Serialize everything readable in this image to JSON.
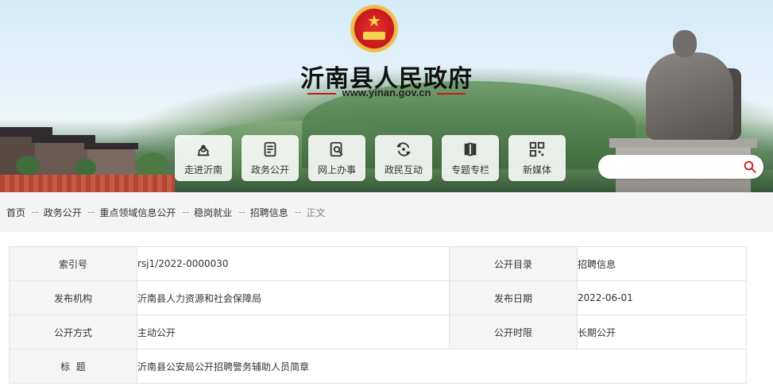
{
  "site": {
    "title": "沂南县人民政府",
    "url": "www.yinan.gov.cn",
    "colors": {
      "accent": "#c8161d",
      "emblem_gold": "#f2c54f"
    }
  },
  "nav": [
    {
      "label": "走进沂南",
      "icon": "landmark-icon"
    },
    {
      "label": "政务公开",
      "icon": "document-icon"
    },
    {
      "label": "网上办事",
      "icon": "search-document-icon"
    },
    {
      "label": "政民互动",
      "icon": "interaction-icon"
    },
    {
      "label": "专题专栏",
      "icon": "books-icon"
    },
    {
      "label": "新媒体",
      "icon": "qrcode-icon"
    }
  ],
  "search": {
    "placeholder": ""
  },
  "breadcrumb": {
    "items": [
      "首页",
      "政务公开",
      "重点领域信息公开",
      "稳岗就业",
      "招聘信息"
    ],
    "separator": "--",
    "current": "正文"
  },
  "info": {
    "index_label": "索引号",
    "index_value": "rsj1/2022-0000030",
    "catalog_label": "公开目录",
    "catalog_value": "招聘信息",
    "org_label": "发布机构",
    "org_value": "沂南县人力资源和社会保障局",
    "date_label": "发布日期",
    "date_value": "2022-06-01",
    "mode_label": "公开方式",
    "mode_value": "主动公开",
    "period_label": "公开时限",
    "period_value": "长期公开",
    "title_label": "标  题",
    "title_value": "沂南县公安局公开招聘警务辅助人员简章"
  }
}
